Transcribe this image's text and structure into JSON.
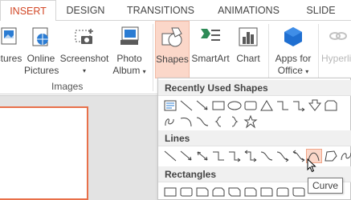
{
  "tabs": [
    "INSERT",
    "DESIGN",
    "TRANSITIONS",
    "ANIMATIONS",
    "SLIDE SHOW"
  ],
  "ribbon": {
    "pictures_label": "ctures",
    "online_pictures_label": [
      "Online",
      "Pictures"
    ],
    "screenshot_label": "Screenshot",
    "photo_album_label": [
      "Photo",
      "Album"
    ],
    "images_group_label": "Images",
    "shapes_label": "Shapes",
    "smartart_label": "SmartArt",
    "chart_label": "Chart",
    "apps_label": [
      "Apps for",
      "Office"
    ],
    "hyperlink_label": "Hyperli"
  },
  "dropdown": {
    "recently_used_label": "Recently Used Shapes",
    "lines_label": "Lines",
    "rectangles_label": "Rectangles"
  },
  "tooltip": "Curve",
  "colors": {
    "accent": "#d24726",
    "hover_fill": "#fbd7c9",
    "slide_border": "#e8704a"
  }
}
